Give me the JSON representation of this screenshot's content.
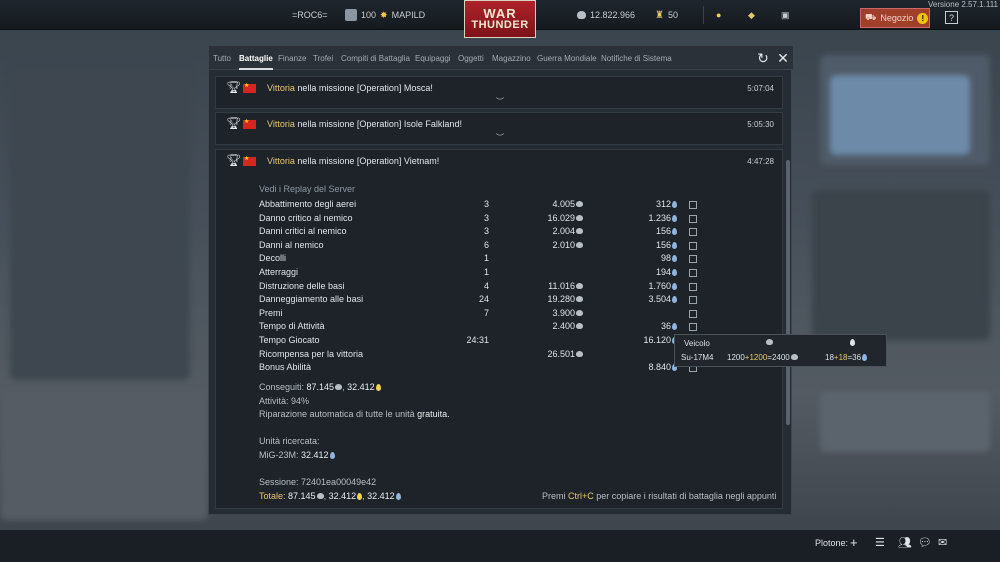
{
  "version": "Versione 2.57.1.111",
  "topbar": {
    "squad_tag": "=ROC6=",
    "level": "100",
    "player_name": "MAPILD",
    "logo_line1": "WAR",
    "logo_line2": "THUNDER",
    "silver_lions": "12.822.966",
    "golden_eagles": "50",
    "shop_label": "Negozio"
  },
  "tabs": [
    "Tutto",
    "Battaglie",
    "Finanze",
    "Trofei",
    "Compiti di Battaglia",
    "Equipaggi",
    "Oggetti",
    "Magazzino",
    "Guerra Mondiale",
    "Notifiche di Sistema"
  ],
  "active_tab": "Battaglie",
  "messages": [
    {
      "prefix": "Vittoria",
      "text": " nella missione [Operation] Mosca!",
      "time": "5:07:04"
    },
    {
      "prefix": "Vittoria",
      "text": " nella missione [Operation] Isole Falkland!",
      "time": "5:05:30"
    },
    {
      "prefix": "Vittoria",
      "text": " nella missione [Operation] Vietnam!",
      "time": "4:47:28"
    }
  ],
  "replay_link": "Vedi i Replay del Server",
  "rows": [
    {
      "name": "Abbattimento degli aerei",
      "count": "3",
      "sl": "4.005",
      "rp": "312"
    },
    {
      "name": "Danno critico al nemico",
      "count": "3",
      "sl": "16.029",
      "rp": "1.236"
    },
    {
      "name": "Danni critici al nemico",
      "count": "3",
      "sl": "2.004",
      "rp": "156"
    },
    {
      "name": "Danni al nemico",
      "count": "6",
      "sl": "2.010",
      "rp": "156"
    },
    {
      "name": "Decolli",
      "count": "1",
      "sl": "",
      "rp": "98"
    },
    {
      "name": "Atterraggi",
      "count": "1",
      "sl": "",
      "rp": "194"
    },
    {
      "name": "Distruzione delle basi",
      "count": "4",
      "sl": "11.016",
      "rp": "1.760"
    },
    {
      "name": "Danneggiamento alle basi",
      "count": "24",
      "sl": "19.280",
      "rp": "3.504"
    },
    {
      "name": "Premi",
      "count": "7",
      "sl": "3.900",
      "rp": ""
    },
    {
      "name": "Tempo di Attività",
      "count": "",
      "sl": "2.400",
      "rp": "36"
    },
    {
      "name": "Tempo Giocato",
      "count": "24:31",
      "sl": "",
      "rp": "16.120"
    },
    {
      "name": "Ricompensa per la vittoria",
      "count": "",
      "sl": "26.501",
      "rp": ""
    },
    {
      "name": "Bonus Abilità",
      "count": "",
      "sl": "",
      "rp": "8.840"
    }
  ],
  "summary": {
    "earned_label": "Conseguiti: ",
    "earned_sl": "87.145",
    "earned_rp": "32.412",
    "activity": "Attività: 94%",
    "repair_prefix": "Riparazione automatica di tutte le unità ",
    "repair_value": "gratuita.",
    "research_label": "Unità ricercata:",
    "research_unit": "MiG-23M: ",
    "research_rp": "32.412",
    "session": "Sessione: 72401ea00049e42",
    "total_label": "Totale: ",
    "total_sl": "87.145",
    "total_rp1": "32.412",
    "total_rp2": "32.412",
    "copy_hint_prefix": "Premi ",
    "copy_hint_key": "Ctrl+C",
    "copy_hint_suffix": " per copiare i risultati di battaglia negli appunti"
  },
  "tooltip": {
    "header": "Veicolo",
    "vehicle": "Su-17M4",
    "sl_formula_a": "1200",
    "sl_formula_b": "1200",
    "sl_formula_c": "2400",
    "rp_formula_a": "18",
    "rp_formula_b": "18",
    "rp_formula_c": "36"
  },
  "bottombar": {
    "platoon_label": "Plotone:"
  },
  "colors": {
    "accent_gold": "#e7c86a",
    "logo_red": "#b0222a",
    "shop_orange": "#a0402a"
  }
}
